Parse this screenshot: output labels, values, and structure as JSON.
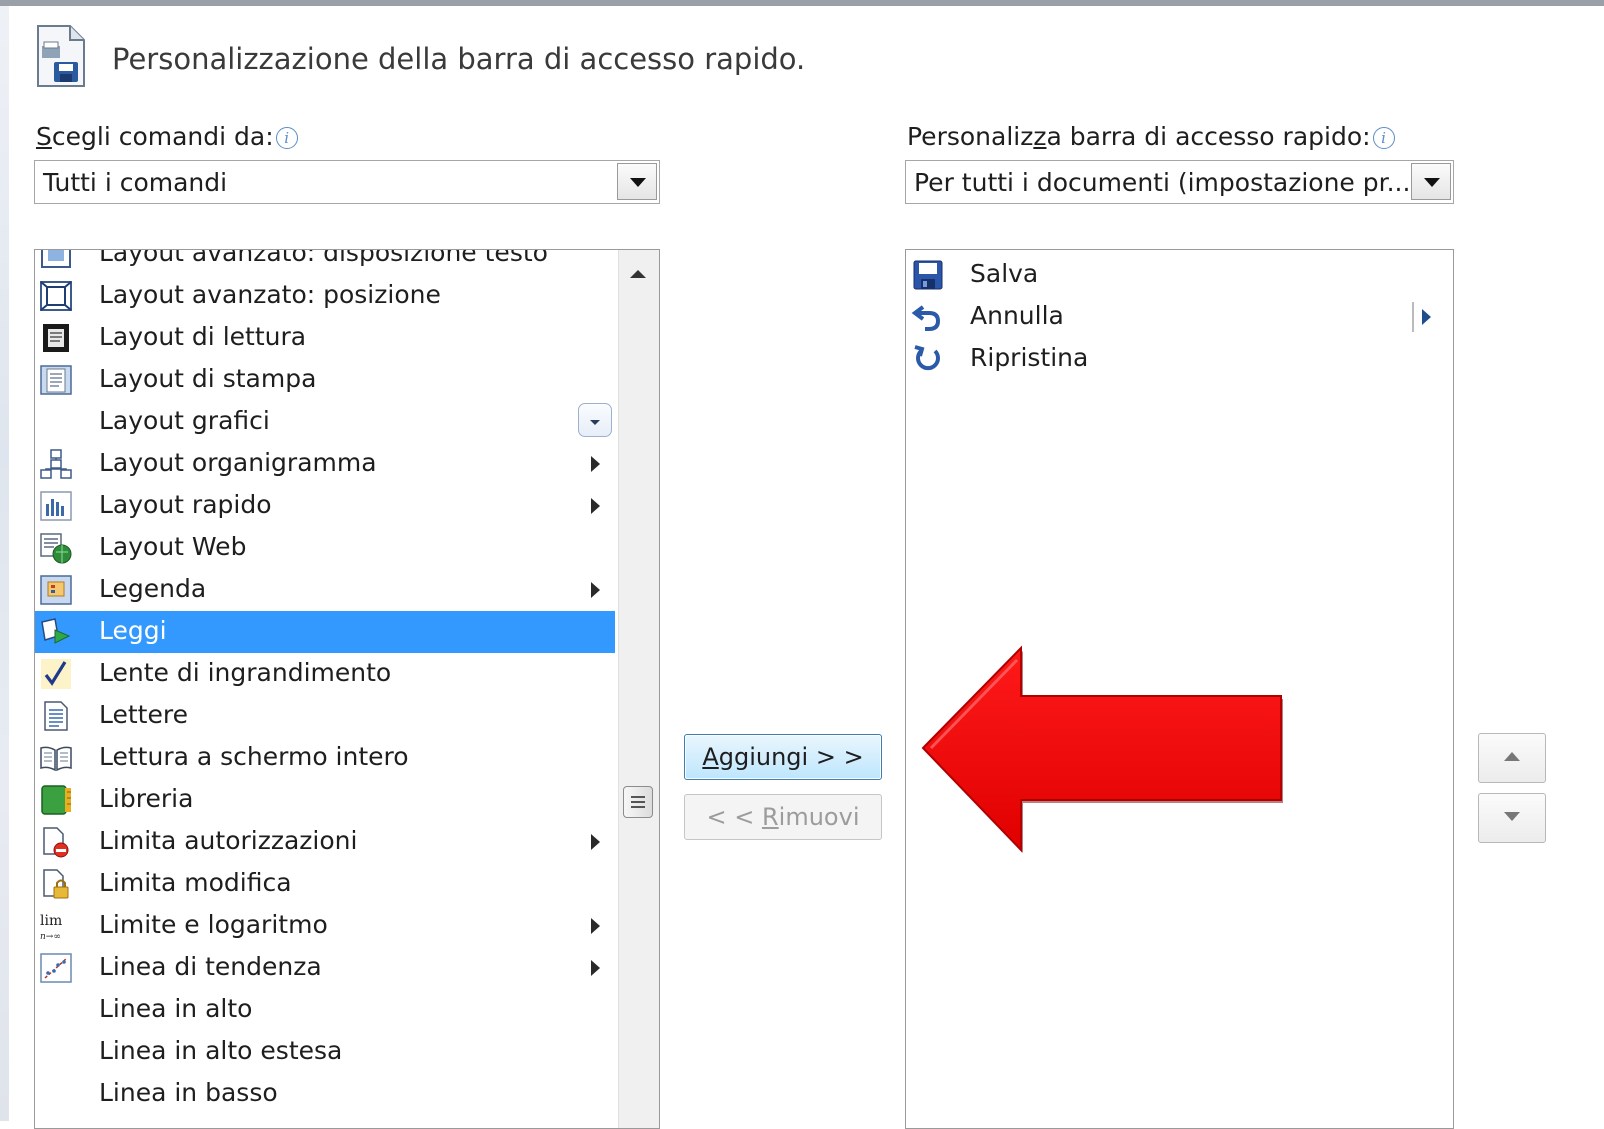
{
  "dialog": {
    "header_title": "Personalizzazione della barra di accesso rapido."
  },
  "left_panel": {
    "label_prefix": "S",
    "label_rest": "cegli comandi da:",
    "info_glyph": "i",
    "combo_value": "Tutti i comandi",
    "items": [
      {
        "label": "Layout avanzato: disposizione testo",
        "icon": "text-wrap-icon",
        "submenu": false
      },
      {
        "label": "Layout avanzato: posizione",
        "icon": "position-icon",
        "submenu": false
      },
      {
        "label": "Layout di lettura",
        "icon": "reading-layout-icon",
        "submenu": false
      },
      {
        "label": "Layout di stampa",
        "icon": "print-layout-icon",
        "submenu": false
      },
      {
        "label": "Layout grafici",
        "icon": "",
        "submenu": false,
        "gallery": true
      },
      {
        "label": "Layout organigramma",
        "icon": "org-chart-icon",
        "submenu": true
      },
      {
        "label": "Layout rapido",
        "icon": "quick-layout-icon",
        "submenu": true
      },
      {
        "label": "Layout Web",
        "icon": "web-layout-icon",
        "submenu": false
      },
      {
        "label": "Legenda",
        "icon": "legend-icon",
        "submenu": true
      },
      {
        "label": "Leggi",
        "icon": "read-icon",
        "submenu": false,
        "selected": true
      },
      {
        "label": "Lente di ingrandimento",
        "icon": "checkmark-icon",
        "submenu": false
      },
      {
        "label": "Lettere",
        "icon": "document-icon",
        "submenu": false
      },
      {
        "label": "Lettura a schermo intero",
        "icon": "open-book-icon",
        "submenu": false
      },
      {
        "label": "Libreria",
        "icon": "library-icon",
        "submenu": false
      },
      {
        "label": "Limita autorizzazioni",
        "icon": "restrict-permission-icon",
        "submenu": true
      },
      {
        "label": "Limita modifica",
        "icon": "restrict-editing-icon",
        "submenu": false
      },
      {
        "label": "Limite e logaritmo",
        "icon": "limit-icon",
        "submenu": true
      },
      {
        "label": "Linea di tendenza",
        "icon": "trendline-icon",
        "submenu": true
      },
      {
        "label": "Linea in alto",
        "icon": "",
        "submenu": false
      },
      {
        "label": "Linea in alto estesa",
        "icon": "",
        "submenu": false
      },
      {
        "label": "Linea in basso",
        "icon": "",
        "submenu": false
      }
    ]
  },
  "right_panel": {
    "label_a": "Personaliz",
    "label_u": "z",
    "label_b": "a barra di accesso rapido:",
    "info_glyph": "i",
    "combo_value": "Per tutti i documenti (impostazione pr...",
    "items": [
      {
        "label": "Salva",
        "icon": "save-icon"
      },
      {
        "label": "Annulla",
        "icon": "undo-icon",
        "submenu": true
      },
      {
        "label": "Ripristina",
        "icon": "redo-icon"
      }
    ]
  },
  "buttons": {
    "add_u": "A",
    "add_rest": "ggiungi > >",
    "remove_pre": "< < ",
    "remove_u": "R",
    "remove_rest": "imuovi"
  },
  "annotation": {
    "arrow_color": "#ff0000",
    "arrow_direction": "left"
  },
  "colors": {
    "selection": "#3399ff",
    "accent": "#3c7fb1"
  }
}
